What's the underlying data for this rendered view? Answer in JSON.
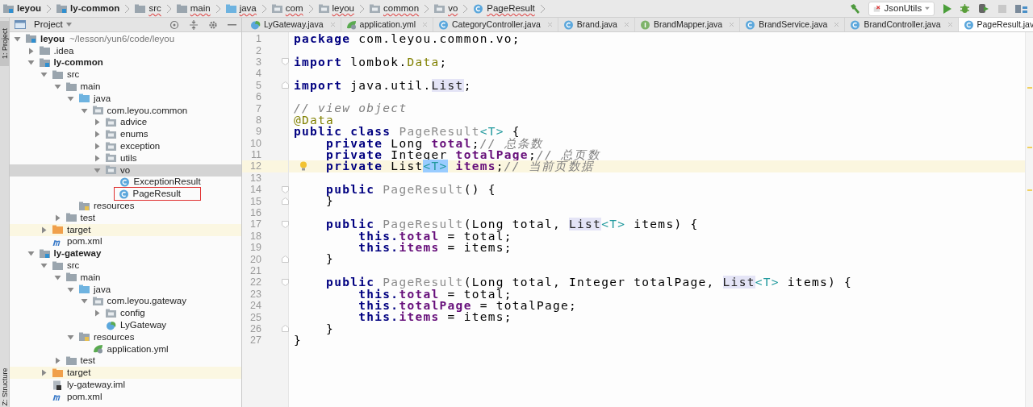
{
  "breadcrumbs": [
    {
      "label": "leyou",
      "kind": "module",
      "underlined": false
    },
    {
      "label": "ly-common",
      "kind": "module",
      "underlined": false
    },
    {
      "label": "src",
      "kind": "folder",
      "underlined": true
    },
    {
      "label": "main",
      "kind": "folder",
      "underlined": true
    },
    {
      "label": "java",
      "kind": "source",
      "underlined": true
    },
    {
      "label": "com",
      "kind": "package",
      "underlined": true
    },
    {
      "label": "leyou",
      "kind": "package",
      "underlined": true
    },
    {
      "label": "common",
      "kind": "package",
      "underlined": true
    },
    {
      "label": "vo",
      "kind": "package",
      "underlined": true
    },
    {
      "label": "PageResult",
      "kind": "class",
      "underlined": true
    }
  ],
  "toolbar": {
    "run_config": "JsonUtils"
  },
  "project_panel": {
    "title": "Project",
    "side_tabs": [
      "1: Project",
      "Z: Structure"
    ]
  },
  "tree": [
    {
      "label": "leyou",
      "detail": "~/lesson/yun6/code/leyou",
      "kind": "module",
      "expanded": true,
      "selected": false,
      "children": [
        {
          "label": ".idea",
          "kind": "folder",
          "expanded": false,
          "selected": false
        },
        {
          "label": "ly-common",
          "kind": "module",
          "expanded": true,
          "selected": false,
          "children": [
            {
              "label": "src",
              "kind": "folder",
              "expanded": true,
              "selected": false,
              "children": [
                {
                  "label": "main",
                  "kind": "folder",
                  "expanded": true,
                  "selected": false,
                  "children": [
                    {
                      "label": "java",
                      "kind": "source",
                      "expanded": true,
                      "selected": false,
                      "children": [
                        {
                          "label": "com.leyou.common",
                          "kind": "package",
                          "expanded": true,
                          "selected": false,
                          "children": [
                            {
                              "label": "advice",
                              "kind": "package",
                              "expanded": false,
                              "selected": false
                            },
                            {
                              "label": "enums",
                              "kind": "package",
                              "expanded": false,
                              "selected": false
                            },
                            {
                              "label": "exception",
                              "kind": "package",
                              "expanded": false,
                              "selected": false
                            },
                            {
                              "label": "utils",
                              "kind": "package",
                              "expanded": false,
                              "selected": false
                            },
                            {
                              "label": "vo",
                              "kind": "package",
                              "expanded": true,
                              "selected": true,
                              "children": [
                                {
                                  "label": "ExceptionResult",
                                  "kind": "class",
                                  "selected": false
                                },
                                {
                                  "label": "PageResult",
                                  "kind": "class",
                                  "selected": false,
                                  "outlined": true
                                }
                              ]
                            }
                          ]
                        }
                      ]
                    },
                    {
                      "label": "resources",
                      "kind": "resources",
                      "selected": false
                    }
                  ]
                },
                {
                  "label": "test",
                  "kind": "folder",
                  "expanded": false,
                  "selected": false
                }
              ]
            },
            {
              "label": "target",
              "kind": "excluded",
              "expanded": false,
              "selected": false
            },
            {
              "label": "pom.xml",
              "kind": "maven",
              "selected": false
            }
          ]
        },
        {
          "label": "ly-gateway",
          "kind": "module",
          "expanded": true,
          "selected": false,
          "children": [
            {
              "label": "src",
              "kind": "folder",
              "expanded": true,
              "selected": false,
              "children": [
                {
                  "label": "main",
                  "kind": "folder",
                  "expanded": true,
                  "selected": false,
                  "children": [
                    {
                      "label": "java",
                      "kind": "source",
                      "expanded": true,
                      "selected": false,
                      "children": [
                        {
                          "label": "com.leyou.gateway",
                          "kind": "package",
                          "expanded": true,
                          "selected": false,
                          "children": [
                            {
                              "label": "config",
                              "kind": "package",
                              "expanded": false,
                              "selected": false
                            },
                            {
                              "label": "LyGateway",
                              "kind": "spring",
                              "selected": false
                            }
                          ]
                        }
                      ]
                    },
                    {
                      "label": "resources",
                      "kind": "resources",
                      "expanded": true,
                      "selected": false,
                      "children": [
                        {
                          "label": "application.yml",
                          "kind": "yml",
                          "selected": false
                        }
                      ]
                    }
                  ]
                },
                {
                  "label": "test",
                  "kind": "folder",
                  "expanded": false,
                  "selected": false
                }
              ]
            },
            {
              "label": "target",
              "kind": "excluded",
              "expanded": false,
              "selected": false
            },
            {
              "label": "ly-gateway.iml",
              "kind": "iml",
              "selected": false
            },
            {
              "label": "pom.xml",
              "kind": "maven",
              "selected": false
            }
          ]
        }
      ]
    }
  ],
  "tabs": [
    {
      "label": "LyGateway.java",
      "kind": "spring",
      "selected": false
    },
    {
      "label": "application.yml",
      "kind": "yml",
      "selected": false
    },
    {
      "label": "CategoryController.java",
      "kind": "class",
      "selected": false
    },
    {
      "label": "Brand.java",
      "kind": "class",
      "selected": false
    },
    {
      "label": "BrandMapper.java",
      "kind": "interface",
      "selected": false
    },
    {
      "label": "BrandService.java",
      "kind": "class",
      "selected": false
    },
    {
      "label": "BrandController.java",
      "kind": "class",
      "selected": false
    },
    {
      "label": "PageResult.jav",
      "kind": "class",
      "selected": true
    }
  ],
  "code": [
    {
      "num": "1",
      "tokens": [
        {
          "kind": "kw",
          "text": "package"
        },
        {
          "kind": "plain",
          "text": " com.leyou.common.vo;"
        }
      ]
    },
    {
      "num": "2"
    },
    {
      "num": "3",
      "fold_open": true,
      "tokens": [
        {
          "kind": "kw",
          "text": "import"
        },
        {
          "kind": "plain",
          "text": " lombok."
        },
        {
          "kind": "ann",
          "text": "Data"
        },
        {
          "kind": "plain",
          "text": ";"
        }
      ]
    },
    {
      "num": "4"
    },
    {
      "num": "5",
      "fold_close": true,
      "tokens": [
        {
          "kind": "kw",
          "text": "import"
        },
        {
          "kind": "plain",
          "text": " java.util."
        },
        {
          "kind": "ref",
          "text": "List"
        },
        {
          "kind": "plain",
          "text": ";"
        }
      ]
    },
    {
      "num": "6"
    },
    {
      "num": "7",
      "tokens": [
        {
          "kind": "comment",
          "text": "// view object"
        }
      ]
    },
    {
      "num": "8",
      "tokens": [
        {
          "kind": "ann",
          "text": "@Data"
        }
      ]
    },
    {
      "num": "9",
      "tokens": [
        {
          "kind": "kw",
          "text": "public class "
        },
        {
          "kind": "decl",
          "text": "PageResult"
        },
        {
          "kind": "tparam",
          "text": "<T>"
        },
        {
          "kind": "plain",
          "text": " {"
        }
      ]
    },
    {
      "num": "10",
      "tokens": [
        {
          "kind": "kw",
          "text": "    private "
        },
        {
          "kind": "plain",
          "text": "Long "
        },
        {
          "kind": "field",
          "text": "total"
        },
        {
          "kind": "plain",
          "text": ";"
        },
        {
          "kind": "comment",
          "text": "// 总条数"
        }
      ]
    },
    {
      "num": "11",
      "tokens": [
        {
          "kind": "kw",
          "text": "    private "
        },
        {
          "kind": "plain",
          "text": "Integer "
        },
        {
          "kind": "field",
          "text": "totalPage"
        },
        {
          "kind": "plain",
          "text": ";"
        },
        {
          "kind": "comment",
          "text": "// 总页数"
        }
      ]
    },
    {
      "num": "12",
      "current": true,
      "bulb": true,
      "tokens": [
        {
          "kind": "kw",
          "text": "    private "
        },
        {
          "kind": "plain",
          "text": "List"
        },
        {
          "kind": "match",
          "text": "<T>"
        },
        {
          "kind": "field",
          "text": " items"
        },
        {
          "kind": "plain",
          "text": ";"
        },
        {
          "kind": "comment",
          "text": "// 当前页数据"
        }
      ]
    },
    {
      "num": "13"
    },
    {
      "num": "14",
      "fold_open": true,
      "tokens": [
        {
          "kind": "kw",
          "text": "    public "
        },
        {
          "kind": "decl",
          "text": "PageResult"
        },
        {
          "kind": "plain",
          "text": "() {"
        }
      ]
    },
    {
      "num": "15",
      "fold_close": true,
      "tokens": [
        {
          "kind": "plain",
          "text": "    }"
        }
      ]
    },
    {
      "num": "16"
    },
    {
      "num": "17",
      "fold_open": true,
      "tokens": [
        {
          "kind": "kw",
          "text": "    public "
        },
        {
          "kind": "decl",
          "text": "PageResult"
        },
        {
          "kind": "plain",
          "text": "(Long total, "
        },
        {
          "kind": "ref",
          "text": "List"
        },
        {
          "kind": "tparam",
          "text": "<T>"
        },
        {
          "kind": "plain",
          "text": " items) {"
        }
      ]
    },
    {
      "num": "18",
      "tokens": [
        {
          "kind": "kw",
          "text": "        this."
        },
        {
          "kind": "field",
          "text": "total"
        },
        {
          "kind": "plain",
          "text": " = total;"
        }
      ]
    },
    {
      "num": "19",
      "tokens": [
        {
          "kind": "kw",
          "text": "        this."
        },
        {
          "kind": "field",
          "text": "items"
        },
        {
          "kind": "plain",
          "text": " = items;"
        }
      ]
    },
    {
      "num": "20",
      "fold_close": true,
      "tokens": [
        {
          "kind": "plain",
          "text": "    }"
        }
      ]
    },
    {
      "num": "21"
    },
    {
      "num": "22",
      "fold_open": true,
      "tokens": [
        {
          "kind": "kw",
          "text": "    public "
        },
        {
          "kind": "decl",
          "text": "PageResult"
        },
        {
          "kind": "plain",
          "text": "(Long total, Integer totalPage, "
        },
        {
          "kind": "ref",
          "text": "List"
        },
        {
          "kind": "tparam",
          "text": "<T>"
        },
        {
          "kind": "plain",
          "text": " items) {"
        }
      ]
    },
    {
      "num": "23",
      "tokens": [
        {
          "kind": "kw",
          "text": "        this."
        },
        {
          "kind": "field",
          "text": "total"
        },
        {
          "kind": "plain",
          "text": " = total;"
        }
      ]
    },
    {
      "num": "24",
      "tokens": [
        {
          "kind": "kw",
          "text": "        this."
        },
        {
          "kind": "field",
          "text": "totalPage"
        },
        {
          "kind": "plain",
          "text": " = totalPage;"
        }
      ]
    },
    {
      "num": "25",
      "tokens": [
        {
          "kind": "kw",
          "text": "        this."
        },
        {
          "kind": "field",
          "text": "items"
        },
        {
          "kind": "plain",
          "text": " = items;"
        }
      ]
    },
    {
      "num": "26",
      "fold_close": true,
      "tokens": [
        {
          "kind": "plain",
          "text": "    }"
        }
      ]
    },
    {
      "num": "27",
      "tokens": [
        {
          "kind": "plain",
          "text": "}"
        }
      ]
    }
  ]
}
